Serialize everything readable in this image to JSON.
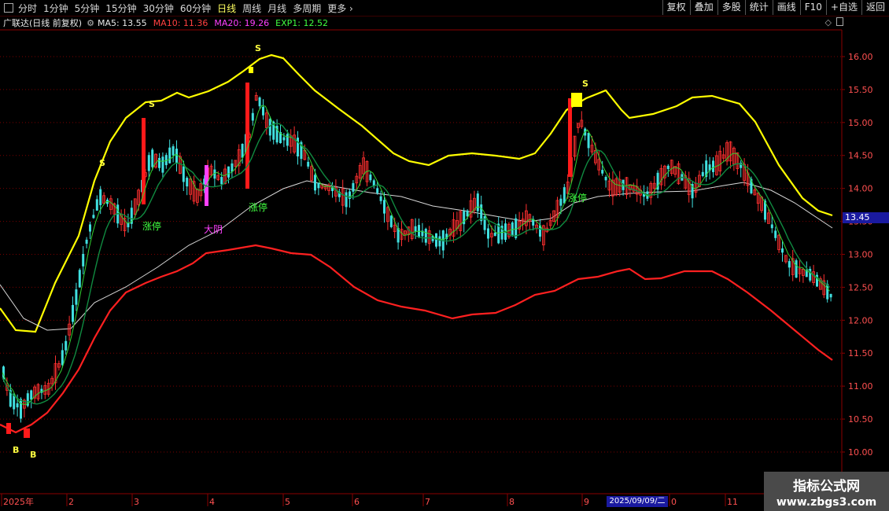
{
  "toolbar": {
    "periods": [
      "分时",
      "1分钟",
      "5分钟",
      "15分钟",
      "30分钟",
      "60分钟",
      "日线",
      "周线",
      "月线",
      "多周期",
      "更多"
    ],
    "active_period": "日线",
    "buttons": [
      "复权",
      "叠加",
      "多股",
      "统计",
      "画线",
      "F10",
      "+自选",
      "返回"
    ]
  },
  "titlebar": {
    "stock_name": "广联达(日线 前复权)",
    "indicators": [
      {
        "label": "MA5: 13.55",
        "color": "#e8e8e8"
      },
      {
        "label": "MA10: 11.36",
        "color": "#ff4040"
      },
      {
        "label": "MA20: 19.26",
        "color": "#ff40ff"
      },
      {
        "label": "EXP1: 12.52",
        "color": "#40ff40"
      }
    ]
  },
  "price_axis": {
    "ticks": [
      "16.00",
      "15.50",
      "15.00",
      "14.50",
      "14.00",
      "13.50",
      "13.00",
      "12.50",
      "12.00",
      "11.50",
      "11.00",
      "10.50",
      "10.00"
    ],
    "current_price": "13.45"
  },
  "time_axis": {
    "labels": [
      "2025年",
      "2",
      "3",
      "4",
      "5",
      "6",
      "7",
      "8",
      "9",
      "0",
      "11"
    ],
    "cursor_date": "2025/09/09/二"
  },
  "chart_data": {
    "type": "candlestick",
    "ylim": [
      9.7,
      16.2
    ],
    "annotations": [
      {
        "text": "涨停",
        "x": 69,
        "y": 13.5,
        "color": "#40ff40"
      },
      {
        "text": "涨停",
        "x": 124,
        "y": 13.7,
        "color": "#40ff40"
      },
      {
        "text": "涨停",
        "x": 284,
        "y": 13.85,
        "color": "#40ff40"
      },
      {
        "text": "大阴",
        "x": 100,
        "y": 13.45,
        "color": "#ff40ff"
      },
      {
        "text": "S",
        "x": 50,
        "y": 14.55,
        "color": "#ffff40"
      },
      {
        "text": "S",
        "x": 75,
        "y": 15.3,
        "color": "#ffff40"
      },
      {
        "text": "S",
        "x": 128,
        "y": 16.1,
        "color": "#ffff40"
      },
      {
        "text": "S",
        "x": 292,
        "y": 15.6,
        "color": "#ffff40"
      },
      {
        "text": "B",
        "x": 7,
        "y": 9.95,
        "color": "#ffff40"
      },
      {
        "text": "B",
        "x": 17,
        "y": 9.9,
        "color": "#ffff40"
      }
    ],
    "upper_band_color": "#ffff00",
    "lower_band_color": "#ff2020"
  },
  "watermark": {
    "title": "指标公式网",
    "url": "www.zbgs3.com"
  }
}
